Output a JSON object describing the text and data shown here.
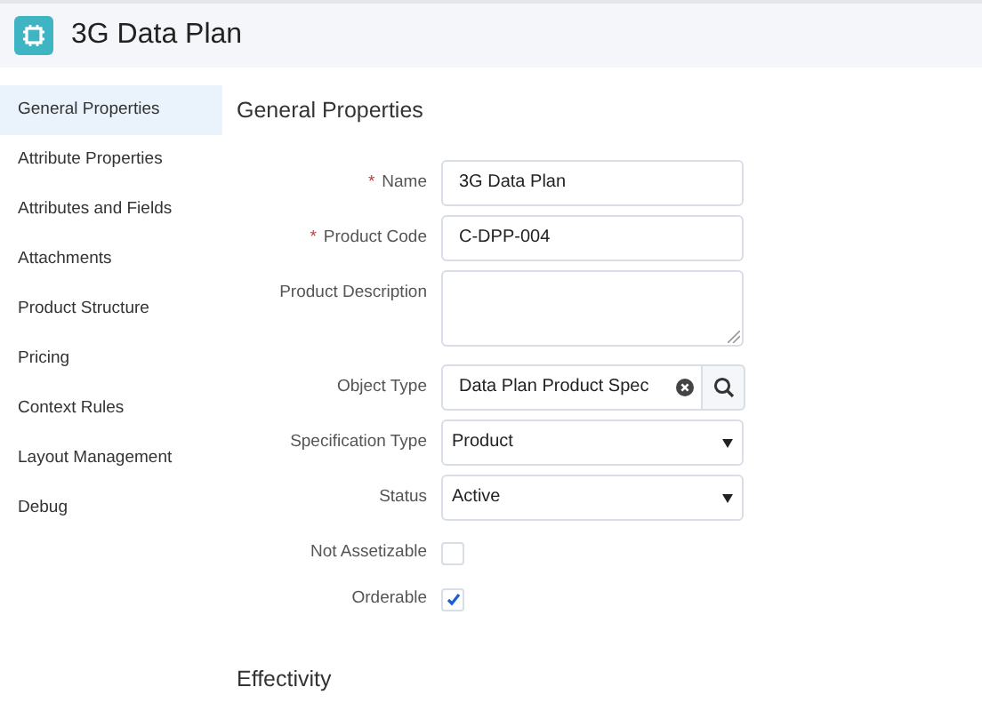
{
  "header": {
    "title": "3G Data Plan"
  },
  "sidebar": {
    "items": [
      {
        "label": "General Properties",
        "selected": true
      },
      {
        "label": "Attribute Properties",
        "selected": false
      },
      {
        "label": "Attributes and Fields",
        "selected": false
      },
      {
        "label": "Attachments",
        "selected": false
      },
      {
        "label": "Product Structure",
        "selected": false
      },
      {
        "label": "Pricing",
        "selected": false
      },
      {
        "label": "Context Rules",
        "selected": false
      },
      {
        "label": "Layout Management",
        "selected": false
      },
      {
        "label": "Debug",
        "selected": false
      }
    ]
  },
  "section_title": "General Properties",
  "fields": [
    {
      "kind": "text",
      "required_mark": "*",
      "label": "Name",
      "value": "3G Data Plan"
    },
    {
      "kind": "text",
      "required_mark": "*",
      "label": "Product Code",
      "value": "C-DPP-004"
    },
    {
      "kind": "textarea",
      "label": "Product Description"
    },
    {
      "kind": "lookup",
      "label": "Object Type",
      "value": "Data Plan Product Spec"
    },
    {
      "kind": "select",
      "label": "Specification Type",
      "value": "Product"
    },
    {
      "kind": "select",
      "label": "Status",
      "value": "Active"
    },
    {
      "kind": "checkbox",
      "label": "Not Assetizable",
      "checked": false
    },
    {
      "kind": "checkbox",
      "label": "Orderable",
      "checked": true
    }
  ],
  "next_section_title": "Effectivity"
}
